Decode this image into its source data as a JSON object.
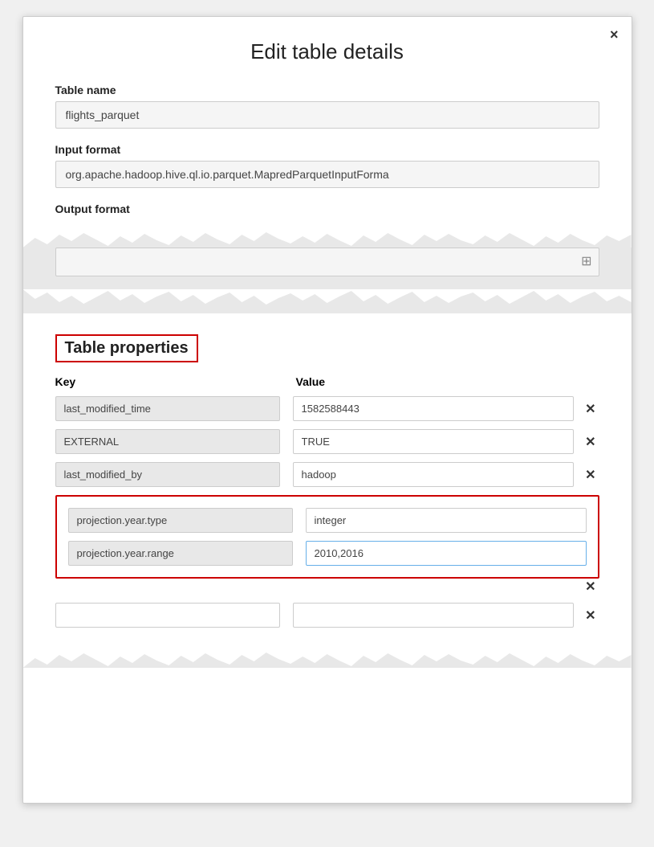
{
  "modal": {
    "title": "Edit table details",
    "close_button": "×"
  },
  "form": {
    "table_name_label": "Table name",
    "table_name_value": "flights_parquet",
    "input_format_label": "Input format",
    "input_format_value": "org.apache.hadoop.hive.ql.io.parquet.MapredParquetInputForma",
    "output_format_label": "Output format"
  },
  "table_properties": {
    "section_title": "Table properties",
    "key_column_label": "Key",
    "value_column_label": "Value",
    "rows": [
      {
        "key": "last_modified_time",
        "value": "1582588443",
        "highlighted": false
      },
      {
        "key": "EXTERNAL",
        "value": "TRUE",
        "highlighted": false
      },
      {
        "key": "last_modified_by",
        "value": "hadoop",
        "highlighted": false
      }
    ],
    "projection_rows": [
      {
        "key": "projection.year.type",
        "value": "integer",
        "highlighted": false
      },
      {
        "key": "projection.year.range",
        "value": "2010,2016",
        "highlighted": true
      }
    ],
    "empty_row": {
      "key": "",
      "value": ""
    }
  },
  "icons": {
    "close": "×",
    "delete": "✕",
    "resize": "⠿"
  }
}
